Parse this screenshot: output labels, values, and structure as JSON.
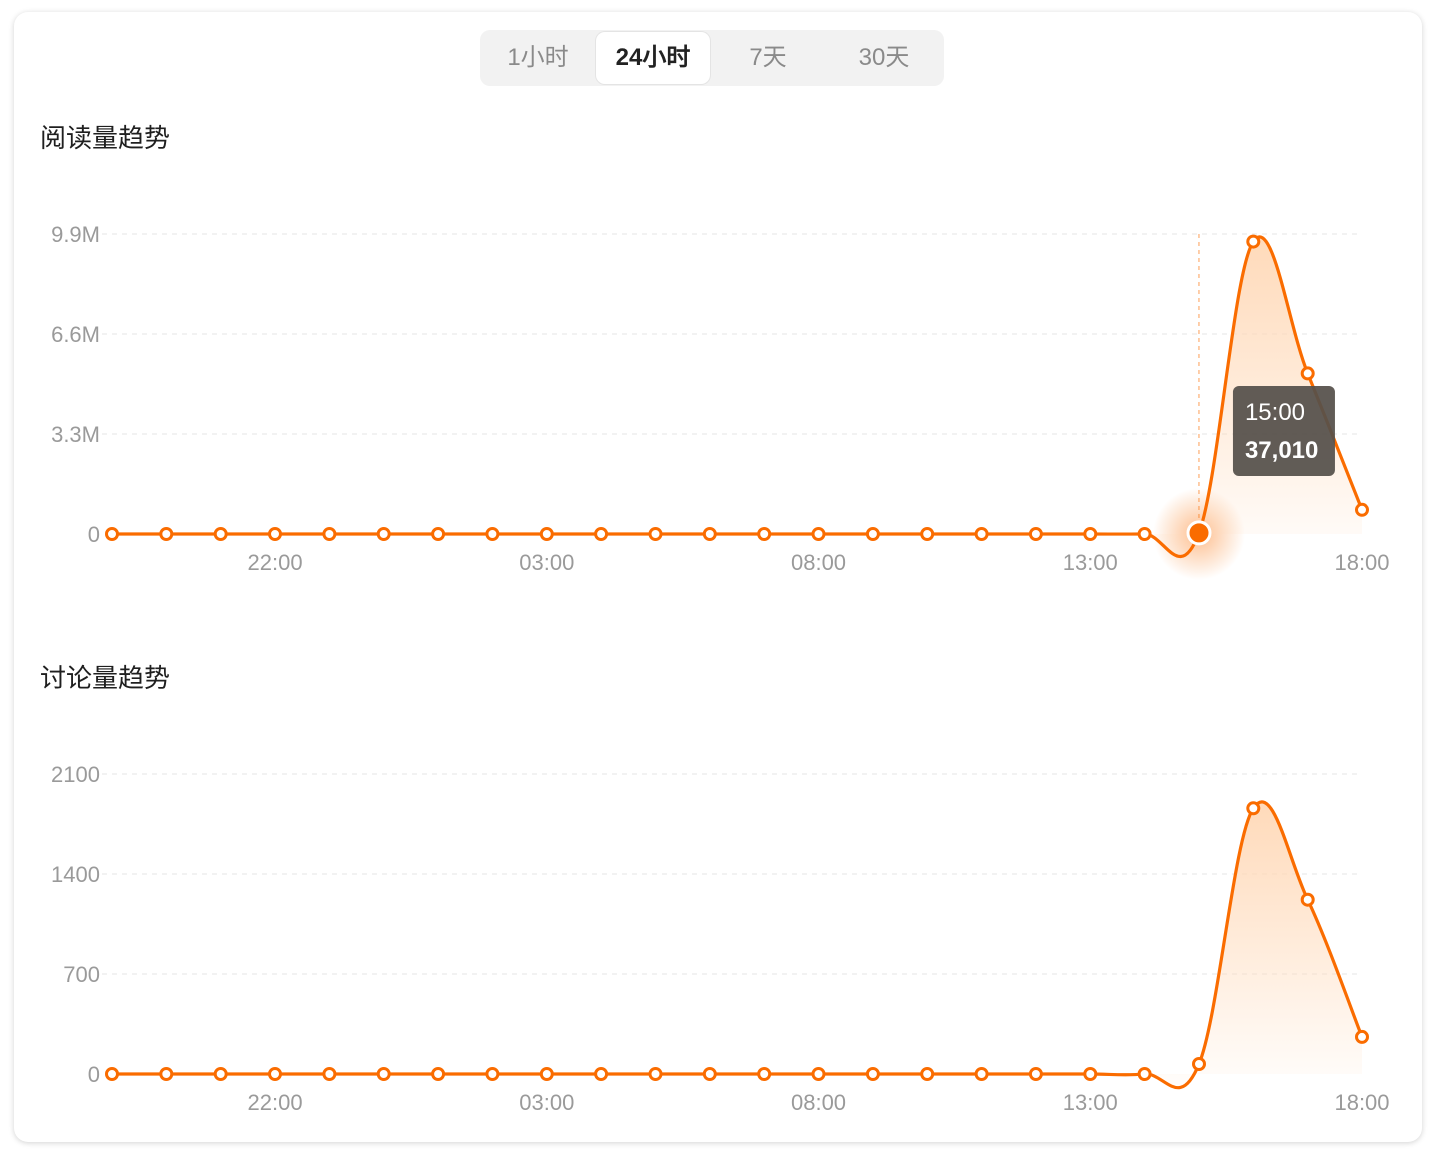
{
  "tabs": [
    {
      "label": "1小时"
    },
    {
      "label": "24小时",
      "active": true
    },
    {
      "label": "7天"
    },
    {
      "label": "30天"
    }
  ],
  "accent": "#fa6c00",
  "fill_color": "#ffd8b6",
  "chart_data": [
    {
      "type": "area",
      "title": "阅读量趋势",
      "x_ticks": [
        "22:00",
        "03:00",
        "08:00",
        "13:00",
        "18:00"
      ],
      "y_ticks": [
        "0",
        "3.3M",
        "6.6M",
        "9.9M"
      ],
      "ylim": [
        0,
        9900000
      ],
      "x_count": 24,
      "values": [
        0,
        0,
        0,
        0,
        0,
        0,
        0,
        0,
        0,
        0,
        0,
        0,
        0,
        0,
        0,
        0,
        0,
        0,
        0,
        0,
        37010,
        9650000,
        5300000,
        800000
      ],
      "highlight_index": 20,
      "tooltip": {
        "time": "15:00",
        "value": "37,010"
      },
      "grid": true
    },
    {
      "type": "area",
      "title": "讨论量趋势",
      "x_ticks": [
        "22:00",
        "03:00",
        "08:00",
        "13:00",
        "18:00"
      ],
      "y_ticks": [
        "0",
        "700",
        "1400",
        "2100"
      ],
      "ylim": [
        0,
        2100
      ],
      "x_count": 24,
      "values": [
        0,
        0,
        0,
        0,
        0,
        0,
        0,
        0,
        0,
        0,
        0,
        0,
        0,
        0,
        0,
        0,
        0,
        0,
        0,
        0,
        70,
        1860,
        1220,
        260
      ],
      "grid": true
    }
  ]
}
